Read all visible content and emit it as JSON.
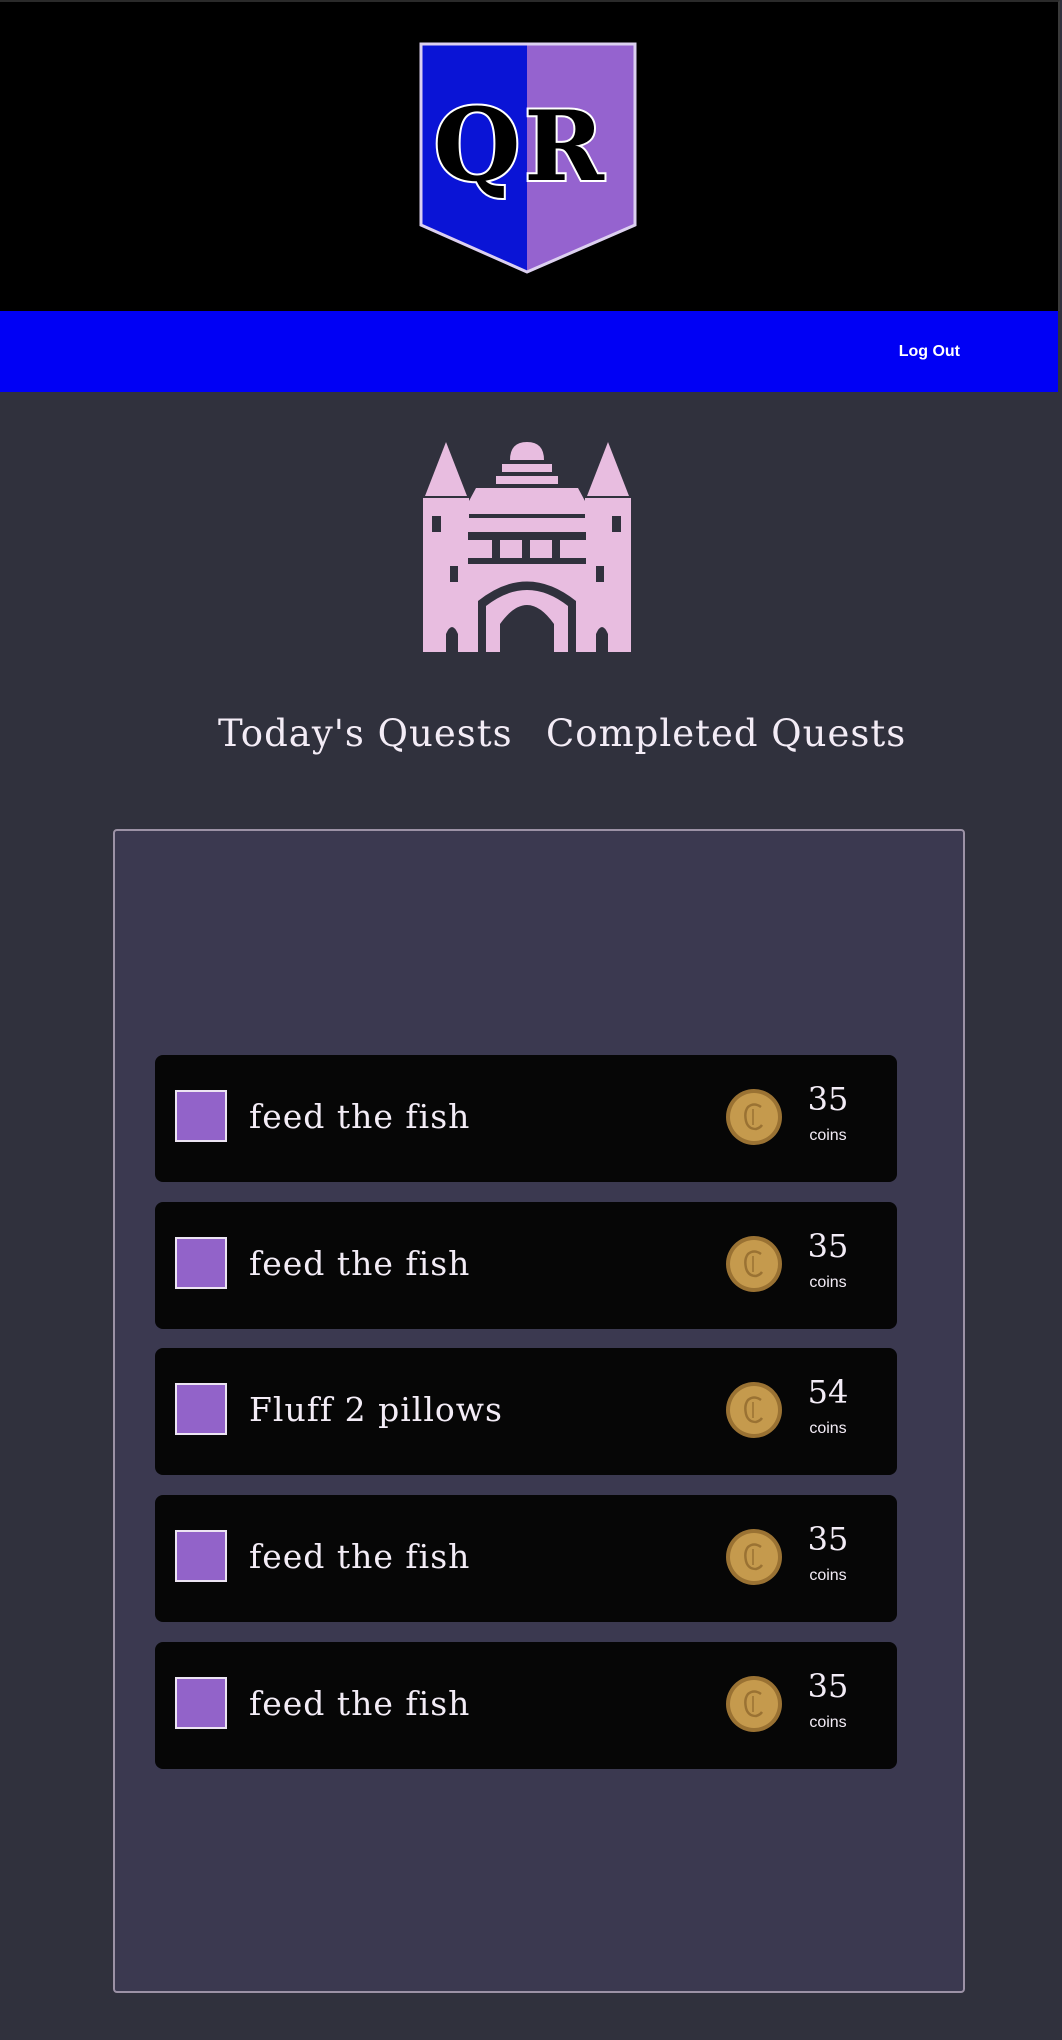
{
  "header": {
    "logo": {
      "letters": "QR",
      "left_color": "#0a14d6",
      "right_color": "#9563cf",
      "icon": "shield-logo"
    }
  },
  "nav": {
    "logout_label": "Log Out",
    "background": "#0000f5"
  },
  "hero": {
    "icon": "castle-icon",
    "color": "#e8bde0"
  },
  "tabs": [
    {
      "label": "Today's Quests"
    },
    {
      "label": "Completed Quests"
    }
  ],
  "quests": [
    {
      "text": "feed the fish",
      "coins": "35",
      "unit": "coins",
      "checked": false
    },
    {
      "text": "feed the fish",
      "coins": "35",
      "unit": "coins",
      "checked": false
    },
    {
      "text": "Fluff 2 pillows",
      "coins": "54",
      "unit": "coins",
      "checked": false
    },
    {
      "text": "feed the fish",
      "coins": "35",
      "unit": "coins",
      "checked": false
    },
    {
      "text": "feed the fish",
      "coins": "35",
      "unit": "coins",
      "checked": false
    }
  ],
  "colors": {
    "page_bg": "#30313d",
    "panel_bg": "#3b3950",
    "card_bg": "#060606",
    "checkbox": "#9263c9",
    "coin": "#c59a4d"
  }
}
